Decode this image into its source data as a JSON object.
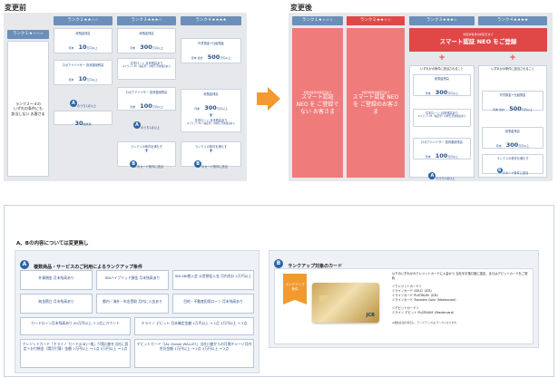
{
  "before": {
    "title": "変更前",
    "columns": [
      {
        "head": "ランク１★☆☆☆",
        "text": "ランク２～４の\nいずれの条件にも\n該当しない お客さま"
      },
      {
        "head": "ランク２★★☆☆",
        "cards": [
          {
            "l1": "総預金残高",
            "l2": "月末",
            "big": "10",
            "l3": "万円以上"
          },
          {
            "l1": "ロボアドバイザー 投資運用残高",
            "l2": "月末",
            "big": "10",
            "l3": "万円以上"
          },
          {
            "l1": "のうち1点以上"
          },
          {
            "big": "30",
            "l3": "歳未満"
          }
        ]
      },
      {
        "head": "ランク３★★★☆",
        "cards": [
          {
            "l1": "総預金残高",
            "l2": "月末",
            "big": "300",
            "l3": "万円以上"
          },
          {
            "l1": "住宅ローン 月末残高あり",
            "l2": "※フラット35（保証型）の場合 月末残高あり"
          },
          {
            "l1": "ロボアドバイザー 投資運用残高",
            "l2": "月末",
            "big": "100",
            "l3": "万円以上"
          },
          {
            "l1": "のうち1点以上"
          },
          {
            "l1": "ランク１の条件を満たす",
            "l2": "のカード条件に該当"
          }
        ]
      },
      {
        "head": "ランク４★★★★",
        "cards": [
          {
            "l1": "外貨預金＋仕組預金",
            "l2": "月末 合計",
            "big": "500",
            "l3": "万円以上"
          },
          {
            "l1": "総預金残高",
            "l2": "月末",
            "big": "300",
            "l3": "万円以上"
          },
          {
            "l1": "住宅ローン 月末残高あり",
            "l2": "※フラット35（保証型）の場合 月末残高あり"
          },
          {
            "l1": "ランク２の条件を満たす",
            "l2": "のカード条件に該当"
          }
        ]
      }
    ]
  },
  "after": {
    "title": "変更後",
    "headers": [
      "ランク１★☆☆☆",
      "ランク２★★☆☆",
      "ランク３★★★☆",
      "ランク４★★★★"
    ],
    "smart_small": "判定対象月内判定日まで",
    "smart_big": "スマート認証 NEO をご登録",
    "col1": "スマート認証 NEO を ご登録でない お客さま",
    "col2": "スマート認証 NEO を ご登録のお客さま",
    "cond_label": "いずれかの条件に該当されること",
    "col3_cards": [
      {
        "l1": "総預金残高",
        "l2": "月末",
        "big": "300",
        "l3": "万円以上"
      },
      {
        "l1": "住宅ローン 月末残高あり",
        "l2": "※フラット35（保証型）の場合 月末残高あり"
      },
      {
        "l1": "ロボアドバイザー 投資運用残高",
        "l2": "月末",
        "big": "100",
        "l3": "万円以上"
      },
      {
        "l1": "のうち1点以上"
      }
    ],
    "col4_cards": [
      {
        "l1": "外貨預金＋仕組預金",
        "l2": "月末 合計",
        "big": "500",
        "l3": "万円以上"
      },
      {
        "l1": "総預金残高",
        "l2": "月末",
        "big": "300",
        "l3": "万円以上"
      },
      {
        "l1": "住宅ローン 月末残高あり",
        "l2": ""
      },
      {
        "l1": "ランク２の条件を満たす",
        "l2": "のカード条件に該当"
      }
    ]
  },
  "bottom": {
    "heading": "A、Bの内容については変更無し",
    "a_title": "複数商品・サービスのご利用によるランクアップ条件",
    "b_title": "ランクアップ対象のカード",
    "a_cells": [
      [
        "外貨預金 月末残高あり",
        "SBIハイブリッド預金 月末残高あり",
        "SBI-SBI勘入会 公営預金入金 月内合計 2万円以上"
      ],
      [
        "純金積立 月末残高あり",
        "都内・海外・年金受取 月内に入金あり",
        "目的・不動産担保ローン 月末残高あり"
      ],
      [
        "カードローン月末残高あり 50万円以上 → 2点にカウント",
        "ミライノ デビット 月末確定金額 1万円以上 → 1点 3万円以上 → 2点"
      ],
      [
        "クレジットカード「ミライノ カード(JCB)一般」引落口座を当社に設定＋お付帳金（請月引落）金額 1万円以上 → 1点 5万円以上 → 2点",
        "デビットカード「JAL Global WALLET」当社口座からの月間チャージ月内合計金額 1万円以上 → 1点 3万円以上 → 2点"
      ]
    ],
    "b_ribbon": "ランクアップ 条件",
    "b_text": "以下のいずれかのクレジットカードに入会かつ 当社を引落口座に設定、またはデビットカードをご契約",
    "b_credit_h": "＜クレジットカード＞",
    "b_credit": [
      "ミライノカード GOLD（JCB）",
      "ミライノカード PLATINUM（JCB）",
      "ミライノカード Travelers Gold（Mastercard）"
    ],
    "b_debit_h": "＜デビットカード＞",
    "b_debit": [
      "ミライノ デビット PLATINUM（Mastercard）"
    ],
    "b_note": "※複数該当の場合も、ランクアップは1ランクとなります。",
    "card_brand": "JCB"
  }
}
